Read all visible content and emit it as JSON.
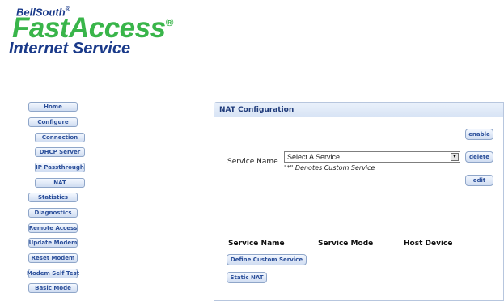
{
  "logo": {
    "brand": "BellSouth",
    "reg": "®",
    "product": "FastAccess",
    "product_reg": "®",
    "tagline": "Internet Service"
  },
  "nav": {
    "home": "Home",
    "configure": "Configure",
    "connection": "Connection",
    "dhcp_server": "DHCP Server",
    "ip_passthrough": "IP Passthrough",
    "nat": "NAT",
    "statistics": "Statistics",
    "diagnostics": "Diagnostics",
    "remote_access": "Remote Access",
    "update_modem": "Update Modem",
    "reset_modem": "Reset Modem",
    "modem_self_test": "Modem Self Test",
    "basic_mode": "Basic Mode"
  },
  "panel": {
    "title": "NAT Configuration",
    "service_name_label": "Service Name",
    "select_value": "Select A Service",
    "select_arrow": "▼",
    "note": "\"*\" Denotes Custom Service",
    "buttons": {
      "enable": "enable",
      "delete": "delete",
      "edit": "edit"
    },
    "columns": {
      "service_name": "Service Name",
      "service_mode": "Service Mode",
      "host_device": "Host Device"
    },
    "actions": {
      "define_custom_service": "Define Custom Service",
      "static_nat": "Static NAT"
    }
  }
}
